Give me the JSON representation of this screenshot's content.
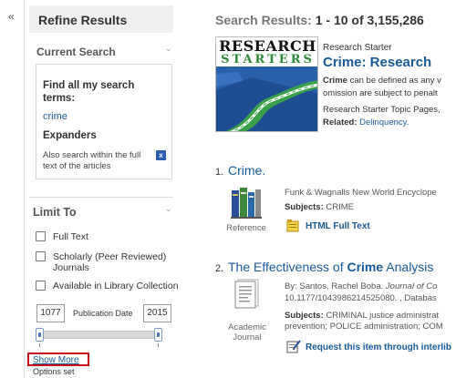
{
  "sidebar": {
    "collapse_glyph": "«",
    "title": "Refine Results",
    "current_search": {
      "heading": "Current Search",
      "find_label": "Find all my search terms:",
      "term": "crime",
      "expanders_heading": "Expanders",
      "also_search": "Also search within the full text of the articles",
      "remove_glyph": "x"
    },
    "limit_to": {
      "heading": "Limit To",
      "options": [
        {
          "label": "Full Text",
          "checked": false
        },
        {
          "label": "Scholarly (Peer Reviewed)",
          "label2": "Journals",
          "checked": false
        },
        {
          "label": "Available in Library Collection",
          "checked": false
        }
      ],
      "publication_date_label": "Publication Date",
      "date_from": "1077",
      "date_to": "2015"
    },
    "show_more": "Show More",
    "options_set": "Options set"
  },
  "results_header": {
    "prefix": "Search Results: ",
    "range": "1 - 10 of 3,155,286"
  },
  "research_starter": {
    "logo_line1": "RESEARCH",
    "logo_line2": "STARTERS",
    "label": "Research Starter",
    "title": "Crime: Research",
    "snippet_bold": "Crime",
    "snippet_line1": " can be defined as any v",
    "snippet_line2": "omission are subject to penalt",
    "topic_line": "Research Starter Topic Pages,",
    "related_label": "Related: ",
    "related_link": "Delinquency."
  },
  "results": [
    {
      "number": "1.",
      "title": "Crime.",
      "source": "Funk & Wagnalls New World Encyclope",
      "subjects_label": "Subjects:",
      "subjects": "CRIME",
      "link_label": "HTML Full Text",
      "type": "Reference"
    },
    {
      "number": "2.",
      "title_prefix": "The Effectiveness of ",
      "title_bold": "Crime",
      "title_suffix": " Analysis",
      "byline_prefix": "By: Santos, Rachel Boba. ",
      "byline_journal": "Journal of Co",
      "doi_line": "10.1177/1043986214525080. , Databas",
      "subjects_label": "Subjects:",
      "subjects_line1": "CRIMINAL justice administrat",
      "subjects_line2": "prevention; POLICE administration; COM",
      "link_label": "Request this item through interlib",
      "type_line1": "Academic",
      "type_line2": "Journal"
    }
  ],
  "colors": {
    "link_blue": "#1a5a9a",
    "highlight_red": "#c4121a",
    "starters_green": "#2e8b3a",
    "remove_button_blue": "#2a5db0"
  },
  "icons": [
    "collapse-chevron-icon",
    "remove-expander-icon",
    "slider-handle-icon",
    "reference-books-icon",
    "html-document-icon",
    "academic-journal-icon",
    "request-item-icon"
  ]
}
